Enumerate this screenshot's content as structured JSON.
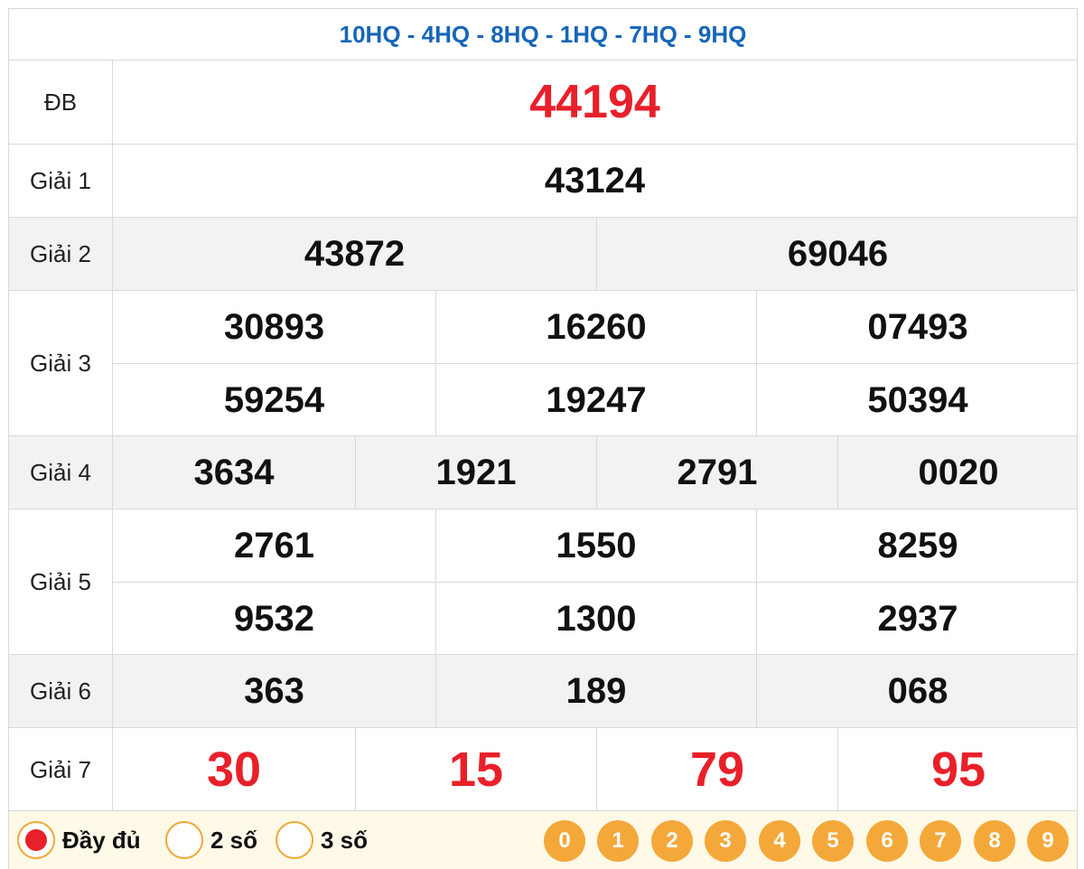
{
  "header": {
    "provinces": "10HQ - 4HQ - 8HQ - 1HQ - 7HQ - 9HQ"
  },
  "prizes": {
    "db": {
      "label": "ĐB",
      "numbers": [
        "44194"
      ]
    },
    "g1": {
      "label": "Giải 1",
      "numbers": [
        "43124"
      ]
    },
    "g2": {
      "label": "Giải 2",
      "numbers": [
        "43872",
        "69046"
      ]
    },
    "g3": {
      "label": "Giải 3",
      "numbers": [
        "30893",
        "16260",
        "07493",
        "59254",
        "19247",
        "50394"
      ]
    },
    "g4": {
      "label": "Giải 4",
      "numbers": [
        "3634",
        "1921",
        "2791",
        "0020"
      ]
    },
    "g5": {
      "label": "Giải 5",
      "numbers": [
        "2761",
        "1550",
        "8259",
        "9532",
        "1300",
        "2937"
      ]
    },
    "g6": {
      "label": "Giải 6",
      "numbers": [
        "363",
        "189",
        "068"
      ]
    },
    "g7": {
      "label": "Giải 7",
      "numbers": [
        "30",
        "15",
        "79",
        "95"
      ]
    }
  },
  "colors": {
    "accent_blue": "#1666b8",
    "red": "#e8202a",
    "orange": "#f5a83a"
  },
  "footer": {
    "options": [
      {
        "label": "Đầy đủ",
        "selected": true
      },
      {
        "label": "2 số",
        "selected": false
      },
      {
        "label": "3 số",
        "selected": false
      }
    ],
    "digits": [
      "0",
      "1",
      "2",
      "3",
      "4",
      "5",
      "6",
      "7",
      "8",
      "9"
    ]
  }
}
